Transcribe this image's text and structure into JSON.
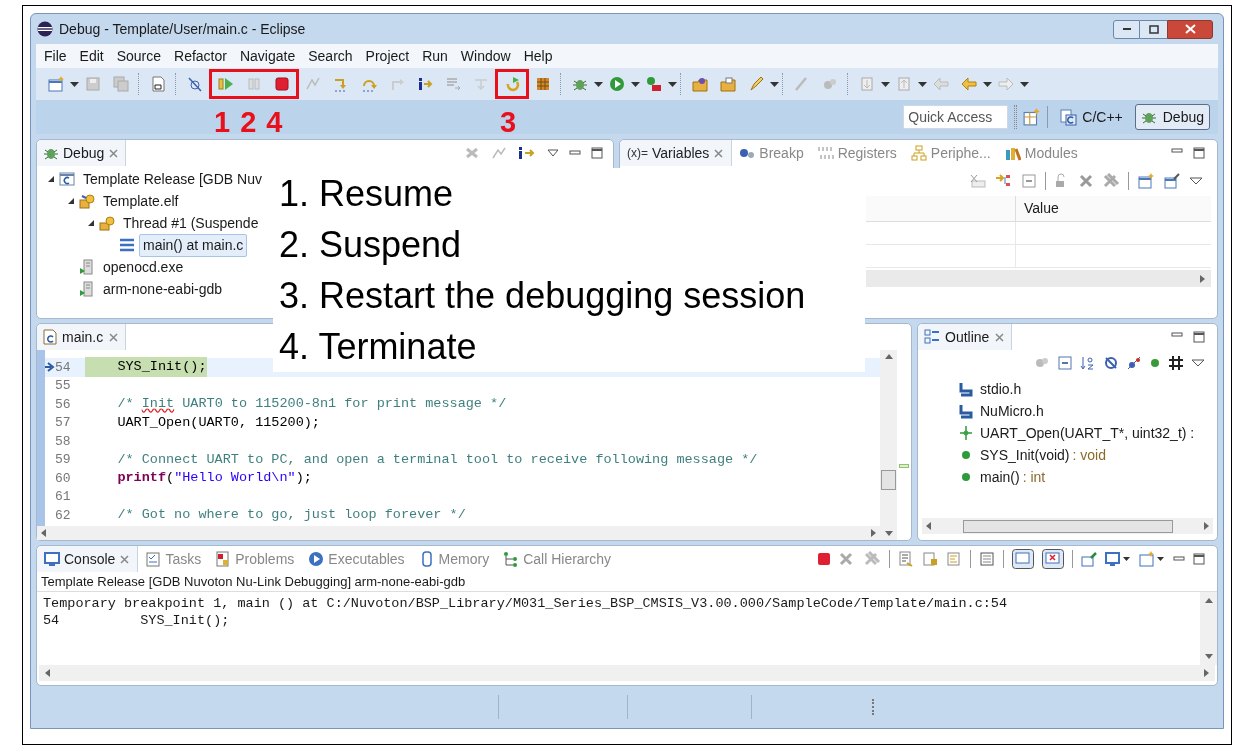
{
  "window": {
    "title": "Debug - Template/User/main.c - Eclipse"
  },
  "menu": [
    "File",
    "Edit",
    "Source",
    "Refactor",
    "Navigate",
    "Search",
    "Project",
    "Run",
    "Window",
    "Help"
  ],
  "toolbar_callouts": [
    {
      "numbers": [
        "1",
        "2",
        "4"
      ]
    },
    {
      "numbers": [
        "3"
      ]
    }
  ],
  "quick_access": {
    "placeholder": "Quick Access"
  },
  "perspectives": [
    {
      "label": "C/C++",
      "kind": "cpp",
      "selected": false
    },
    {
      "label": "Debug",
      "kind": "debug",
      "selected": true
    }
  ],
  "debug_view": {
    "tab": "Debug",
    "tree": [
      {
        "label": "Template Release [GDB Nuv",
        "kind": "launch",
        "expanded": true,
        "selected": false,
        "children": [
          {
            "label": "Template.elf",
            "kind": "program",
            "expanded": true,
            "selected": false,
            "children": [
              {
                "label": "Thread #1 (Suspende",
                "kind": "thread",
                "expanded": true,
                "selected": false,
                "children": [
                  {
                    "label": "main() at main.c",
                    "kind": "frame",
                    "selected": true
                  }
                ]
              }
            ]
          },
          {
            "label": "openocd.exe",
            "kind": "process",
            "selected": false
          },
          {
            "label": "arm-none-eabi-gdb",
            "kind": "process",
            "selected": false
          }
        ]
      }
    ]
  },
  "variables_view": {
    "tabs": [
      {
        "label": "Variables",
        "kind": "variables",
        "icon_text": "(x)=",
        "selected": true
      },
      {
        "label": "Breakp",
        "kind": "breakpoints",
        "selected": false
      },
      {
        "label": "Registers",
        "kind": "registers",
        "selected": false
      },
      {
        "label": "Periphe...",
        "kind": "peripherals",
        "selected": false
      },
      {
        "label": "Modules",
        "kind": "modules",
        "selected": false
      }
    ],
    "columns": [
      "Value"
    ]
  },
  "annotations": [
    "1. Resume",
    "2. Suspend",
    "3. Restart the debugging session",
    "4. Terminate"
  ],
  "editor": {
    "tab": "main.c",
    "lines": [
      {
        "number": "54",
        "current": true,
        "segments": [
          {
            "text": "    SYS_Init();",
            "kind": "plain"
          }
        ]
      },
      {
        "number": "55",
        "current": false
      },
      {
        "number": "56",
        "current": false,
        "segments": [
          {
            "text": "    /* ",
            "kind": "comment"
          },
          {
            "text": "Init",
            "kind": "misspelled"
          },
          {
            "text": " UART0 to 115200-8n1 for print message */",
            "kind": "comment"
          }
        ]
      },
      {
        "number": "57",
        "current": false,
        "segments": [
          {
            "text": "    UART_Open(UART0, 115200);",
            "kind": "plain"
          }
        ]
      },
      {
        "number": "58",
        "current": false
      },
      {
        "number": "59",
        "current": false,
        "segments": [
          {
            "text": "    /* Connect UART to PC, and open a terminal tool to receive following message */",
            "kind": "comment"
          }
        ]
      },
      {
        "number": "60",
        "current": false,
        "segments": [
          {
            "text": "    printf",
            "kind": "keyword"
          },
          {
            "text": "(",
            "kind": "plain"
          },
          {
            "text": "\"Hello World\\n\"",
            "kind": "string"
          },
          {
            "text": ");",
            "kind": "plain"
          }
        ]
      },
      {
        "number": "61",
        "current": false
      },
      {
        "number": "62",
        "current": false,
        "segments": [
          {
            "text": "    /* Got no where to go, just loop forever */",
            "kind": "comment"
          }
        ]
      }
    ]
  },
  "outline_view": {
    "tab": "Outline",
    "items": [
      {
        "kind": "include",
        "label": "stdio.h"
      },
      {
        "kind": "include",
        "label": "NuMicro.h"
      },
      {
        "kind": "declaration",
        "label": "UART_Open(UART_T*, uint32_t) :"
      },
      {
        "kind": "function",
        "label": "SYS_Init(void)",
        "type": ": void"
      },
      {
        "kind": "function",
        "label": "main()",
        "type": ": int"
      }
    ]
  },
  "console_view": {
    "tabs": [
      {
        "label": "Console",
        "kind": "console",
        "selected": true
      },
      {
        "label": "Tasks",
        "kind": "tasks",
        "selected": false
      },
      {
        "label": "Problems",
        "kind": "problems",
        "selected": false
      },
      {
        "label": "Executables",
        "kind": "executables",
        "selected": false
      },
      {
        "label": "Memory",
        "kind": "memory",
        "selected": false
      },
      {
        "label": "Call Hierarchy",
        "kind": "call-hierarchy",
        "selected": false
      }
    ],
    "header": "Template Release [GDB Nuvoton Nu-Link Debugging] arm-none-eabi-gdb",
    "lines": [
      "Temporary breakpoint 1, main () at C:/Nuvoton/BSP_Library/M031_Series_BSP_CMSIS_V3.00.000/SampleCode/Template/main.c:54",
      "54          SYS_Init();"
    ]
  }
}
